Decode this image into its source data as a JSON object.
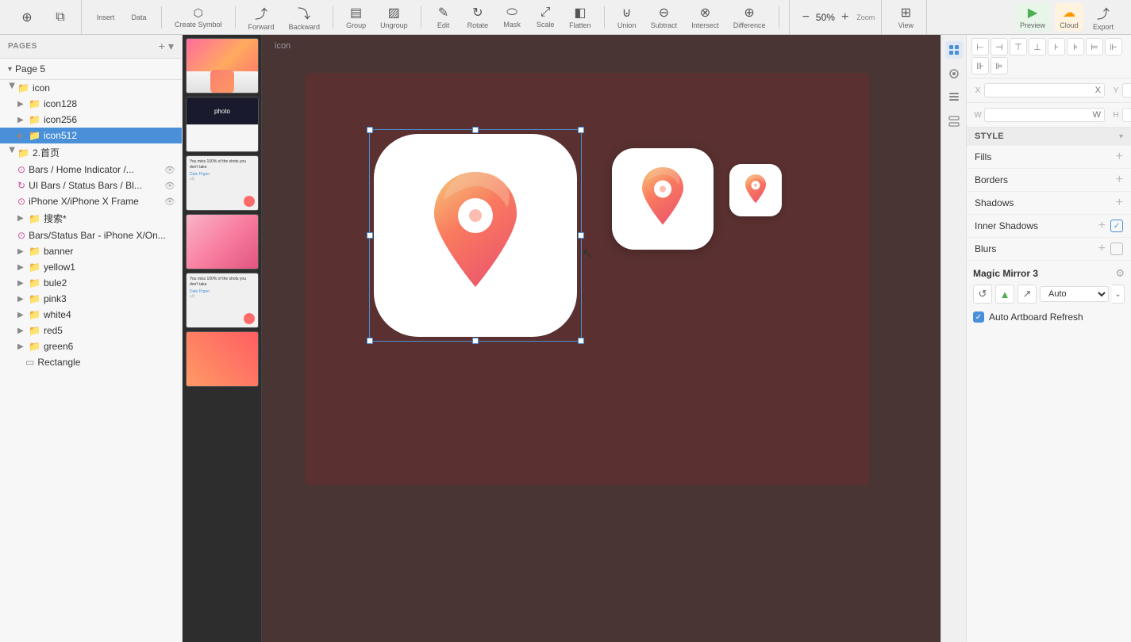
{
  "toolbar": {
    "insert_label": "Insert",
    "data_label": "Data",
    "create_symbol_label": "Create Symbol",
    "forward_label": "Forward",
    "backward_label": "Backward",
    "group_label": "Group",
    "ungroup_label": "Ungroup",
    "edit_label": "Edit",
    "rotate_label": "Rotate",
    "mask_label": "Mask",
    "scale_label": "Scale",
    "flatten_label": "Flatten",
    "union_label": "Union",
    "subtract_label": "Subtract",
    "intersect_label": "Intersect",
    "difference_label": "Difference",
    "zoom_label": "Zoom",
    "zoom_value": "50%",
    "view_label": "View",
    "preview_label": "Preview",
    "cloud_label": "Cloud",
    "export_label": "Export"
  },
  "pages": {
    "header": "PAGES",
    "current_page": "Page 5",
    "add_icon": "+",
    "menu_icon": "▾"
  },
  "layers": {
    "root_group": "icon",
    "items": [
      {
        "id": "icon128",
        "name": "icon128",
        "type": "folder",
        "depth": 1,
        "expanded": false
      },
      {
        "id": "icon256",
        "name": "icon256",
        "type": "folder",
        "depth": 1,
        "expanded": false
      },
      {
        "id": "icon512",
        "name": "icon512",
        "type": "folder",
        "depth": 1,
        "expanded": false,
        "selected": true
      },
      {
        "id": "2首页",
        "name": "2.首页",
        "type": "folder",
        "depth": 0,
        "expanded": true
      },
      {
        "id": "bars-home",
        "name": "Bars / Home Indicator /...",
        "type": "symbol",
        "depth": 1,
        "hasVisibility": true
      },
      {
        "id": "ui-bars",
        "name": "UI Bars / Status Bars / Bl...",
        "type": "symbol",
        "depth": 1,
        "hasVisibility": true
      },
      {
        "id": "iphone-x",
        "name": "iPhone X/iPhone X Frame",
        "type": "symbol",
        "depth": 1,
        "hasVisibility": true
      },
      {
        "id": "search",
        "name": "搜索*",
        "type": "folder",
        "depth": 1,
        "expanded": false
      },
      {
        "id": "bars-status",
        "name": "Bars/Status Bar - iPhone X/On...",
        "type": "symbol",
        "depth": 1
      },
      {
        "id": "banner",
        "name": "banner",
        "type": "folder",
        "depth": 1,
        "expanded": false
      },
      {
        "id": "yellow1",
        "name": "yellow1",
        "type": "folder",
        "depth": 1,
        "expanded": false
      },
      {
        "id": "bule2",
        "name": "bule2",
        "type": "folder",
        "depth": 1,
        "expanded": false
      },
      {
        "id": "pink3",
        "name": "pink3",
        "type": "folder",
        "depth": 1,
        "expanded": false
      },
      {
        "id": "white4",
        "name": "white4",
        "type": "folder",
        "depth": 1,
        "expanded": false
      },
      {
        "id": "red5",
        "name": "red5",
        "type": "folder",
        "depth": 1,
        "expanded": false
      },
      {
        "id": "green6",
        "name": "green6",
        "type": "folder",
        "depth": 1,
        "expanded": false
      },
      {
        "id": "rectangle",
        "name": "Rectangle",
        "type": "rectangle",
        "depth": 1
      }
    ]
  },
  "canvas": {
    "artboard_label": "icon",
    "background_color": "#5c3535"
  },
  "coordinates": {
    "x_label": "X",
    "x_value": "",
    "y_label": "Y",
    "y_value": "",
    "w_label": "W",
    "w_value": "",
    "h_label": "H",
    "h_value": ""
  },
  "style_panel": {
    "style_label": "STYLE",
    "arrow": "▾",
    "fills_label": "Fills",
    "borders_label": "Borders",
    "shadows_label": "Shadows",
    "inner_shadows_label": "Inner Shadows",
    "blurs_label": "Blurs"
  },
  "magic_mirror": {
    "title": "Magic Mirror 3",
    "auto_label": "Auto",
    "auto_refresh_label": "Auto Artboard Refresh"
  },
  "arrange_toolbar": {
    "btns": [
      "⊞",
      "⊟",
      "⊠",
      "⊡",
      "⊞",
      "⊟",
      "⊠",
      "⊡",
      "⊞",
      "⊟"
    ]
  }
}
